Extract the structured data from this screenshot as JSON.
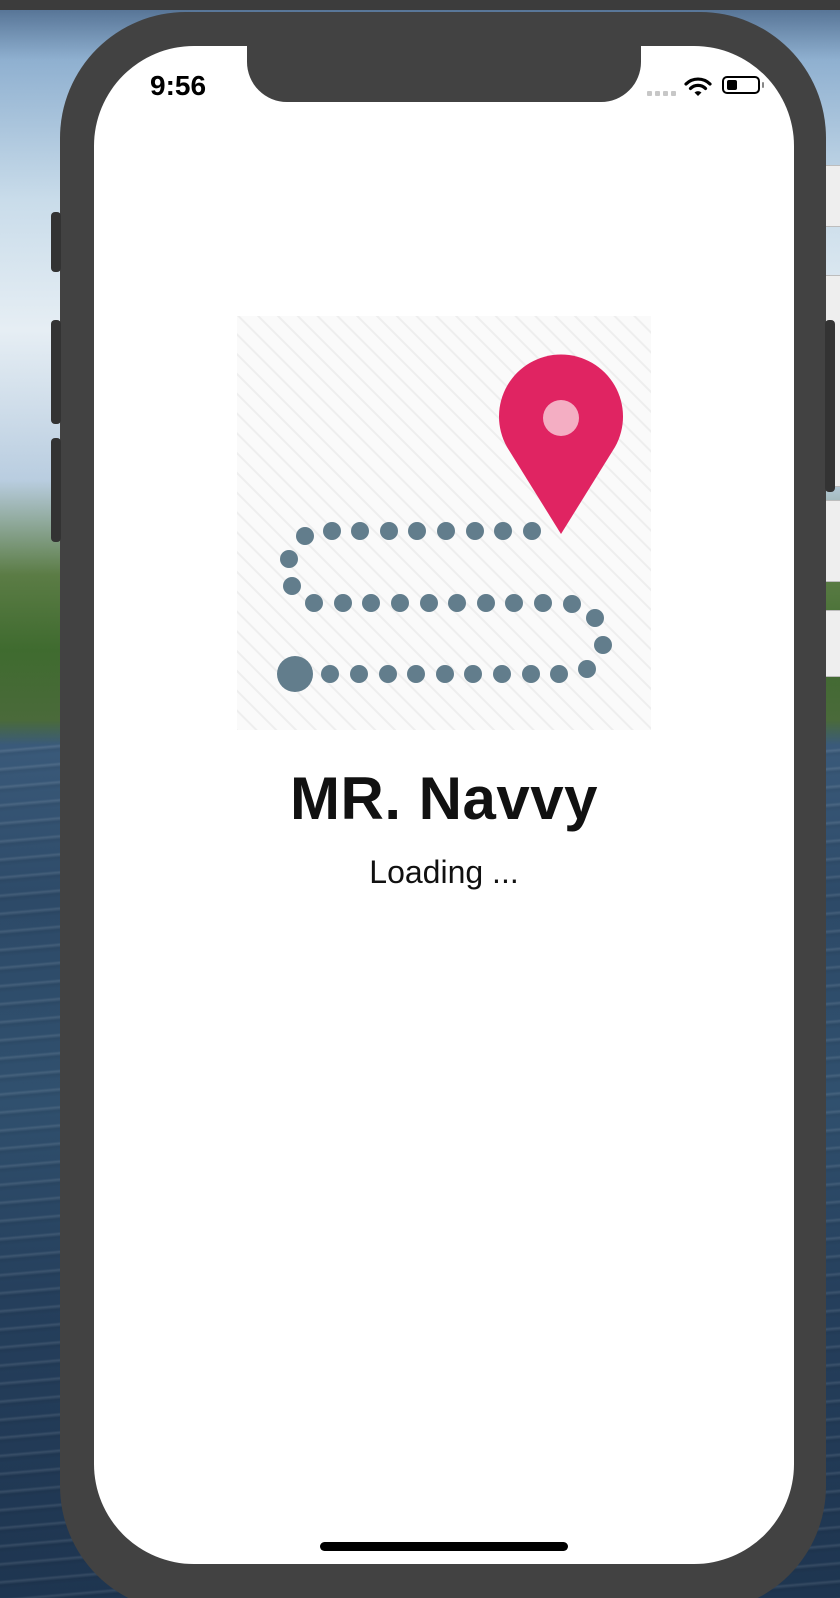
{
  "status_bar": {
    "time": "9:56"
  },
  "app": {
    "title": "MR. Navvy",
    "loading": "Loading ..."
  },
  "icons": {
    "logo": "route-map-pin-icon",
    "wifi": "wifi-icon",
    "battery": "battery-icon",
    "signal": "cellular-signal-icon"
  },
  "colors": {
    "pin": "#e02462",
    "pin_dot": "#f4aec3",
    "route_dots": "#627d8c",
    "device_frame": "#424242"
  }
}
